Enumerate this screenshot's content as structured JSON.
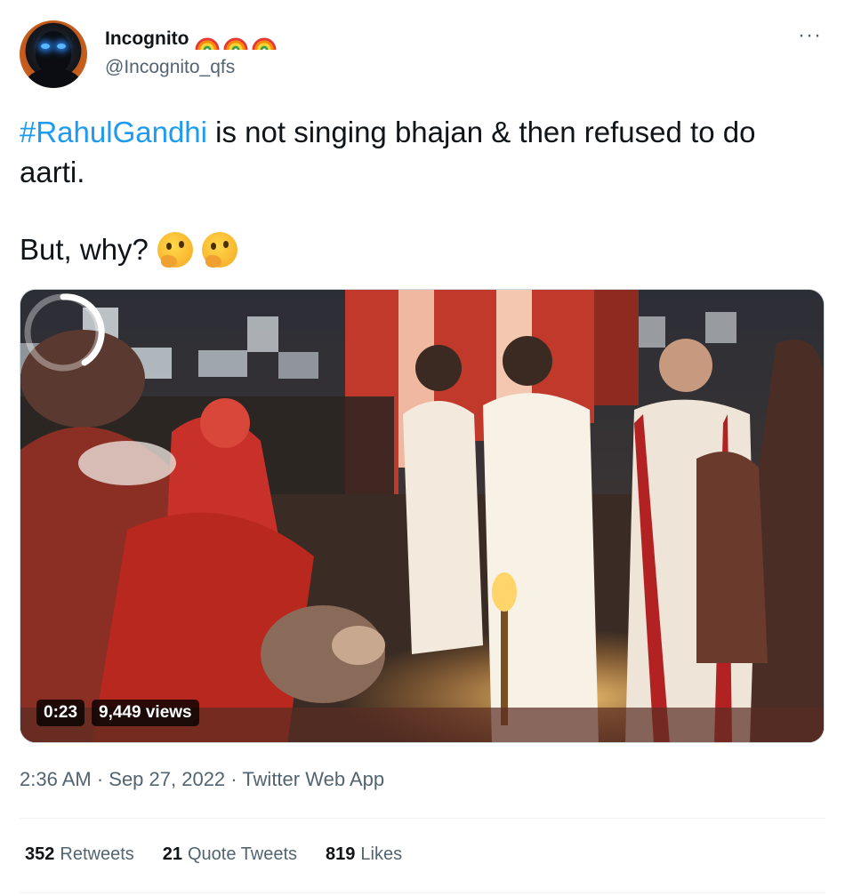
{
  "author": {
    "display_name": "Incognito",
    "handle": "@Incognito_qfs",
    "name_emoji": [
      "rainbow-icon",
      "rainbow-icon",
      "rainbow-icon"
    ]
  },
  "more_icon": "more-dots-icon",
  "tweet": {
    "hashtag": "#RahulGandhi",
    "text": " is not singing bhajan & then refused to do aarti.",
    "second_line": "But, why?",
    "emoji": [
      "thinking-face-icon",
      "thinking-face-icon"
    ]
  },
  "video": {
    "duration": "0:23",
    "views": "9,449 views",
    "state": "loading-spinner"
  },
  "meta": {
    "timestamp": "2:36 AM · Sep 27, 2022 · Twitter Web App"
  },
  "stats": {
    "retweets_count": "352",
    "retweets_label": "Retweets",
    "quotes_count": "21",
    "quotes_label": "Quote Tweets",
    "likes_count": "819",
    "likes_label": "Likes"
  },
  "colors": {
    "link": "#1d9bf0",
    "secondary_text": "#536471",
    "primary_text": "#0f1419"
  }
}
